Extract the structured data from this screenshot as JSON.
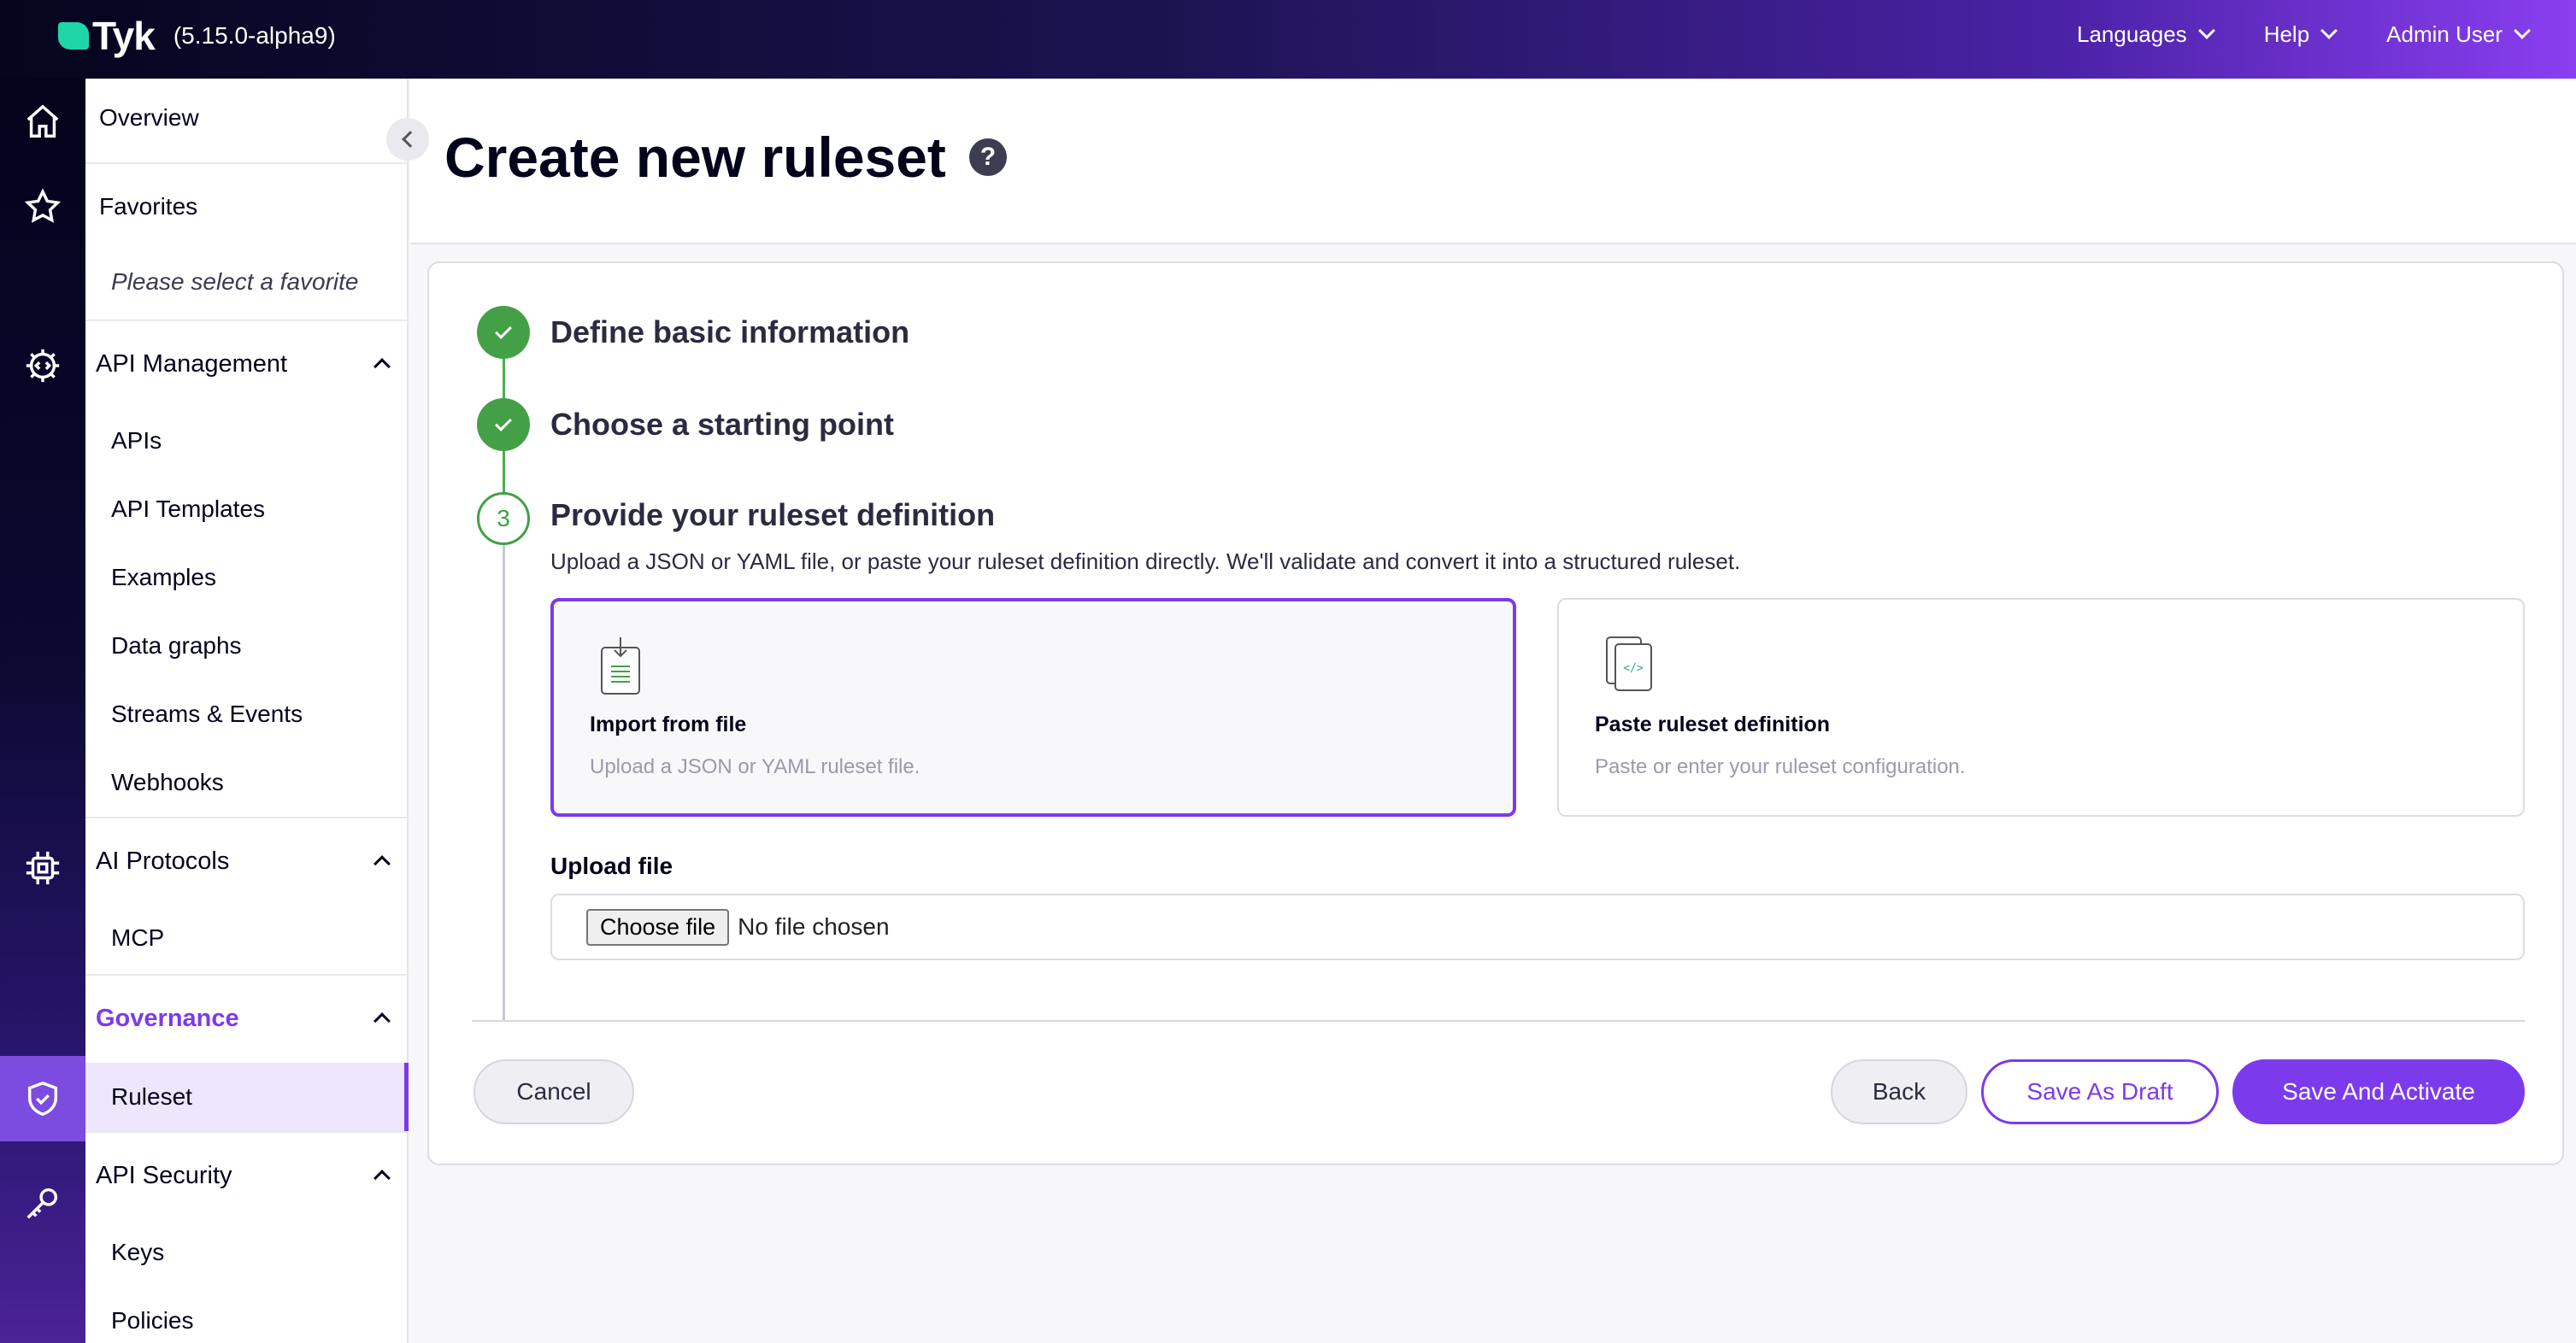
{
  "topbar": {
    "logo_text": "Tyk",
    "version": "(5.15.0-alpha9)",
    "nav": [
      "Languages",
      "Help",
      "Admin User"
    ]
  },
  "rail_icons": [
    "home-icon",
    "star-icon",
    "gear-code-icon",
    "chip-icon",
    "shield-check-icon",
    "key-icon"
  ],
  "sidebar": {
    "overview": "Overview",
    "favorites": "Favorites",
    "favorites_placeholder": "Please select a favorite",
    "sections": [
      {
        "title": "API Management",
        "items": [
          "APIs",
          "API Templates",
          "Examples",
          "Data graphs",
          "Streams & Events",
          "Webhooks"
        ]
      },
      {
        "title": "AI Protocols",
        "items": [
          "MCP"
        ]
      },
      {
        "title": "Governance",
        "items": [
          "Ruleset"
        ]
      },
      {
        "title": "API Security",
        "items": [
          "Keys",
          "Policies"
        ]
      }
    ]
  },
  "page": {
    "title": "Create new ruleset",
    "help": "?"
  },
  "steps": [
    {
      "title": "Define basic information",
      "state": "done"
    },
    {
      "title": "Choose a starting point",
      "state": "done"
    },
    {
      "number": "3",
      "title": "Provide your ruleset definition",
      "state": "current",
      "description": "Upload a JSON or YAML file, or paste your ruleset definition directly. We'll validate and convert it into a structured ruleset."
    }
  ],
  "options": [
    {
      "title": "Import from file",
      "subtitle": "Upload a JSON or YAML ruleset file.",
      "selected": true
    },
    {
      "title": "Paste ruleset definition",
      "subtitle": "Paste or enter your ruleset configuration.",
      "selected": false
    }
  ],
  "upload": {
    "label": "Upload file",
    "button": "Choose file",
    "status": "No file chosen"
  },
  "actions": {
    "cancel": "Cancel",
    "back": "Back",
    "draft": "Save As Draft",
    "activate": "Save And Activate"
  },
  "colors": {
    "accent": "#7c3aed",
    "success": "#43a047",
    "logo": "#20d6a8"
  }
}
